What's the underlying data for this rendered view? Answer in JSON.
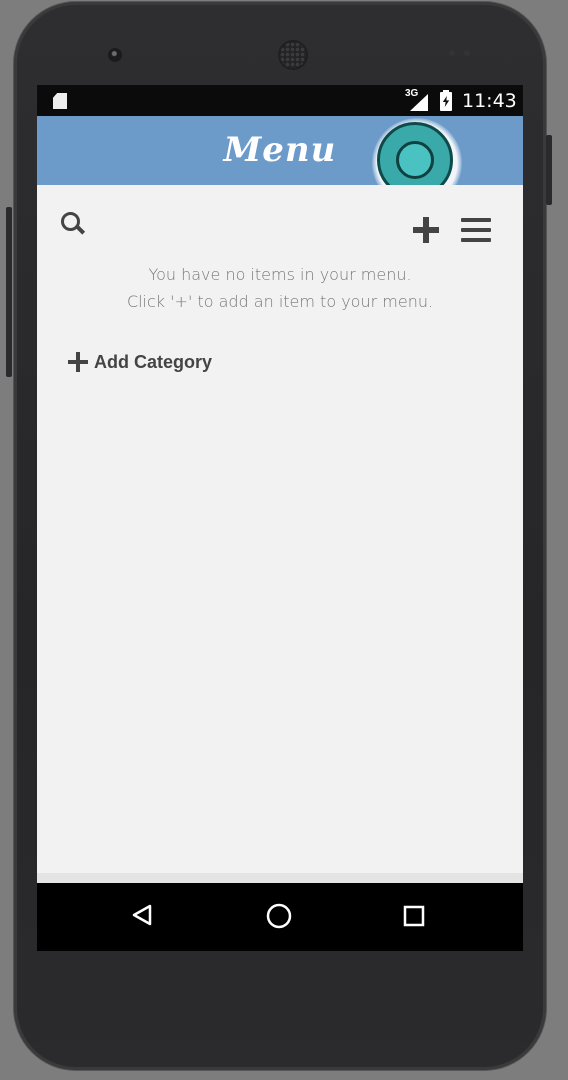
{
  "status_bar": {
    "network": "3G",
    "time": "11:43",
    "icons": [
      "sd-card-icon",
      "signal-icon",
      "battery-charging-icon"
    ]
  },
  "app_bar": {
    "title": "Menu",
    "background": "#6d9bc9"
  },
  "toolbar": {
    "icons": [
      "search-icon",
      "plus-icon",
      "hamburger-menu-icon"
    ]
  },
  "empty_state": {
    "line1": "You have no items in your menu.",
    "line2": "Click '+' to add an item to your menu."
  },
  "add_category": {
    "label": "Add Category"
  },
  "nav_bar": {
    "icons": [
      "back-icon",
      "home-icon",
      "recents-icon"
    ]
  },
  "colors": {
    "touch_indicator": "#3aa9a9",
    "content_bg": "#f2f2f2",
    "icon_color": "#444444"
  }
}
